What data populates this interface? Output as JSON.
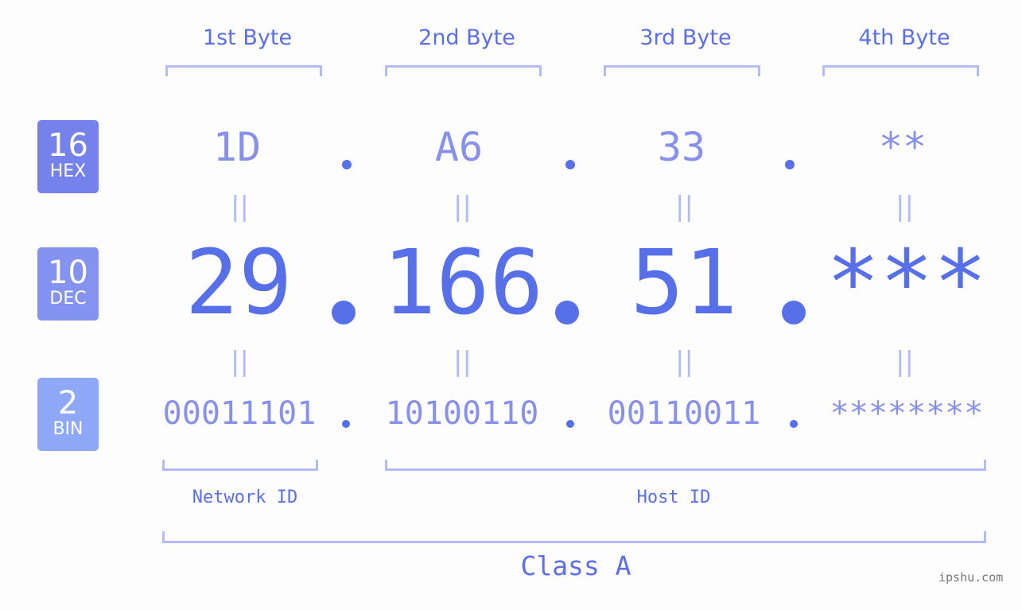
{
  "badges": [
    {
      "number": "16",
      "label": "HEX",
      "color": "#7582eb"
    },
    {
      "number": "10",
      "label": "DEC",
      "color": "#8593f0"
    },
    {
      "number": "2",
      "label": "BIN",
      "color": "#8fa7f7"
    }
  ],
  "bytes": [
    {
      "label": "1st Byte",
      "hex": "1D",
      "dec": "29",
      "bin": "00011101"
    },
    {
      "label": "2nd Byte",
      "hex": "A6",
      "dec": "166",
      "bin": "10100110"
    },
    {
      "label": "3rd Byte",
      "hex": "33",
      "dec": "51",
      "bin": "00110011"
    },
    {
      "label": "4th Byte",
      "hex": "**",
      "dec": "***",
      "bin": "********"
    }
  ],
  "equals_symbol": "||",
  "network_id_label": "Network ID",
  "host_id_label": "Host ID",
  "class_label": "Class A",
  "watermark": "ipshu.com",
  "colors": {
    "accent": "#5770ea",
    "light_accent": "#8791ec",
    "bracket": "#b3bcf7"
  }
}
